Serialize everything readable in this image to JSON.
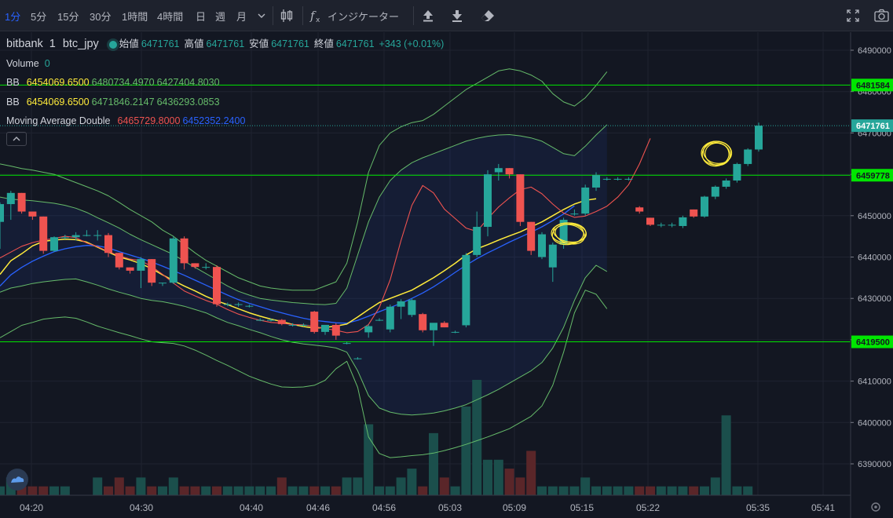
{
  "toolbar": {
    "intervals": [
      "1分",
      "5分",
      "15分",
      "30分",
      "1時間",
      "4時間",
      "日",
      "週",
      "月"
    ],
    "active_interval": "1分",
    "indicators_label": "インジケーター",
    "icons": [
      "chevron-down-icon",
      "candles-icon",
      "fx-icon",
      "upload-icon",
      "download-icon",
      "eraser-icon",
      "fullscreen-icon",
      "camera-icon"
    ]
  },
  "legend": {
    "exchange": "bitbank",
    "interval": "1",
    "symbol": "btc_jpy",
    "open_label": "始値",
    "open": "6471761",
    "high_label": "高値",
    "high": "6471761",
    "low_label": "安値",
    "low": "6471761",
    "close_label": "終値",
    "close": "6471761",
    "change": "+343 (+0.01%)",
    "volume_label": "Volume",
    "volume": "0",
    "bb1": {
      "label": "BB",
      "basis": "6454069.6500",
      "upper": "6480734.4970",
      "lower": "6427404.8030"
    },
    "bb2": {
      "label": "BB",
      "basis": "6454069.6500",
      "upper": "6471846.2147",
      "lower": "6436293.0853"
    },
    "ma": {
      "label": "Moving Average Double",
      "v1": "6465729.8000",
      "v2": "6452352.2400"
    }
  },
  "price_axis": {
    "ticks": [
      "6490000",
      "6480000",
      "6470000",
      "6460000",
      "6450000",
      "6440000",
      "6430000",
      "6420000",
      "6410000",
      "6400000",
      "6390000"
    ],
    "min": 6385000,
    "max": 6494000,
    "markers": [
      {
        "label": "6481584",
        "bg": "#00e600",
        "fg": "#131722"
      },
      {
        "label": "6471761",
        "bg": "#26a69a",
        "fg": "#ffffff"
      },
      {
        "label": "6459778",
        "bg": "#00e600",
        "fg": "#131722"
      },
      {
        "label": "6419500",
        "bg": "#00e600",
        "fg": "#131722"
      }
    ]
  },
  "time_axis": {
    "labels": [
      "04:20",
      "04:30",
      "04:40",
      "04:46",
      "04:56",
      "05:03",
      "05:09",
      "05:15",
      "05:22",
      "05:35",
      "05:41"
    ]
  },
  "chart_data": {
    "type": "candlestick",
    "x_labels": [
      "04:20",
      "04:30",
      "04:40",
      "04:46",
      "04:56",
      "05:03",
      "05:09",
      "05:15",
      "05:22",
      "05:35",
      "05:41"
    ],
    "horizontal_lines": [
      6481584,
      6459778,
      6419500
    ],
    "last_price": 6471761,
    "colors": {
      "up": "#26a69a",
      "down": "#ef5350",
      "hline": "#00e600",
      "bb": "#66bb6a",
      "basis_band": "#ffeb3b",
      "ma_fast": "#ef5350",
      "ma_slow": "#2962ff"
    },
    "candles": [
      {
        "o": 6448500,
        "h": 6453200,
        "l": 6442000,
        "c": 6452800
      },
      {
        "o": 6452800,
        "h": 6456000,
        "l": 6449000,
        "c": 6455500
      },
      {
        "o": 6455500,
        "h": 6455500,
        "l": 6450500,
        "c": 6451000
      },
      {
        "o": 6451000,
        "h": 6451000,
        "l": 6449000,
        "c": 6449800
      },
      {
        "o": 6449800,
        "h": 6449800,
        "l": 6440800,
        "c": 6441500
      },
      {
        "o": 6441500,
        "h": 6445000,
        "l": 6441200,
        "c": 6444800
      },
      {
        "o": 6444800,
        "h": 6445400,
        "l": 6444300,
        "c": 6444800
      },
      {
        "o": 6444800,
        "h": 6446000,
        "l": 6444000,
        "c": 6445300
      },
      {
        "o": 6445300,
        "h": 6446500,
        "l": 6445000,
        "c": 6445300
      },
      {
        "o": 6445300,
        "h": 6446500,
        "l": 6444000,
        "c": 6445300
      },
      {
        "o": 6445300,
        "h": 6445800,
        "l": 6440000,
        "c": 6441000
      },
      {
        "o": 6441000,
        "h": 6441000,
        "l": 6437000,
        "c": 6437500
      },
      {
        "o": 6437500,
        "h": 6437500,
        "l": 6436000,
        "c": 6436700
      },
      {
        "o": 6436700,
        "h": 6440000,
        "l": 6432500,
        "c": 6439500
      },
      {
        "o": 6439500,
        "h": 6439500,
        "l": 6433000,
        "c": 6433800
      },
      {
        "o": 6433800,
        "h": 6433800,
        "l": 6433000,
        "c": 6433800
      },
      {
        "o": 6433800,
        "h": 6445000,
        "l": 6433500,
        "c": 6444500
      },
      {
        "o": 6444500,
        "h": 6445000,
        "l": 6437000,
        "c": 6438500
      },
      {
        "o": 6438500,
        "h": 6438500,
        "l": 6437200,
        "c": 6437600
      },
      {
        "o": 6437600,
        "h": 6438500,
        "l": 6437000,
        "c": 6437600
      },
      {
        "o": 6437600,
        "h": 6438000,
        "l": 6428000,
        "c": 6428600
      },
      {
        "o": 6428600,
        "h": 6429000,
        "l": 6428100,
        "c": 6428600
      },
      {
        "o": 6428600,
        "h": 6429000,
        "l": 6428000,
        "c": 6428600
      },
      {
        "o": 6428200,
        "h": 6428500,
        "l": 6427800,
        "c": 6428200
      },
      {
        "o": 6424800,
        "h": 6425200,
        "l": 6424500,
        "c": 6424800
      },
      {
        "o": 6424800,
        "h": 6425200,
        "l": 6424400,
        "c": 6424800
      },
      {
        "o": 6424800,
        "h": 6425000,
        "l": 6423500,
        "c": 6423800
      },
      {
        "o": 6423600,
        "h": 6424000,
        "l": 6423200,
        "c": 6423600
      },
      {
        "o": 6423600,
        "h": 6424000,
        "l": 6423200,
        "c": 6423600
      },
      {
        "o": 6426800,
        "h": 6427000,
        "l": 6421500,
        "c": 6421900
      },
      {
        "o": 6421900,
        "h": 6422500,
        "l": 6421200,
        "c": 6423600
      },
      {
        "o": 6423600,
        "h": 6424000,
        "l": 6420000,
        "c": 6421000
      },
      {
        "o": 6419200,
        "h": 6419500,
        "l": 6418900,
        "c": 6419200
      },
      {
        "o": 6415500,
        "h": 6415800,
        "l": 6415200,
        "c": 6415500
      },
      {
        "o": 6421800,
        "h": 6423700,
        "l": 6420500,
        "c": 6423300
      },
      {
        "o": 6424800,
        "h": 6425200,
        "l": 6424500,
        "c": 6424800
      },
      {
        "o": 6422500,
        "h": 6428500,
        "l": 6421800,
        "c": 6428000
      },
      {
        "o": 6428000,
        "h": 6429800,
        "l": 6425000,
        "c": 6429300
      },
      {
        "o": 6426000,
        "h": 6430000,
        "l": 6425500,
        "c": 6429600
      },
      {
        "o": 6426200,
        "h": 6426500,
        "l": 6421800,
        "c": 6422300
      },
      {
        "o": 6422300,
        "h": 6422600,
        "l": 6418500,
        "c": 6424100
      },
      {
        "o": 6424100,
        "h": 6424500,
        "l": 6423000,
        "c": 6423000
      },
      {
        "o": 6421900,
        "h": 6422200,
        "l": 6421600,
        "c": 6421900
      },
      {
        "o": 6423500,
        "h": 6441000,
        "l": 6423000,
        "c": 6440500
      },
      {
        "o": 6440500,
        "h": 6451000,
        "l": 6440000,
        "c": 6447300
      },
      {
        "o": 6447300,
        "h": 6461000,
        "l": 6445000,
        "c": 6460000
      },
      {
        "o": 6460500,
        "h": 6462500,
        "l": 6458500,
        "c": 6461500
      },
      {
        "o": 6461500,
        "h": 6461500,
        "l": 6459000,
        "c": 6460000
      },
      {
        "o": 6460000,
        "h": 6460000,
        "l": 6447500,
        "c": 6448500
      },
      {
        "o": 6448500,
        "h": 6448500,
        "l": 6440500,
        "c": 6441500
      },
      {
        "o": 6440000,
        "h": 6446000,
        "l": 6439500,
        "c": 6445500
      },
      {
        "o": 6437500,
        "h": 6443500,
        "l": 6434000,
        "c": 6443000
      },
      {
        "o": 6443000,
        "h": 6449500,
        "l": 6442000,
        "c": 6449000
      },
      {
        "o": 6450500,
        "h": 6451500,
        "l": 6450000,
        "c": 6450500
      },
      {
        "o": 6450500,
        "h": 6457500,
        "l": 6450000,
        "c": 6456800
      },
      {
        "o": 6456800,
        "h": 6460500,
        "l": 6456000,
        "c": 6459800
      },
      {
        "o": 6458900,
        "h": 6459300,
        "l": 6458500,
        "c": 6458900
      },
      {
        "o": 6458900,
        "h": 6459300,
        "l": 6458500,
        "c": 6458900
      },
      {
        "o": 6458900,
        "h": 6459300,
        "l": 6458500,
        "c": 6458900
      },
      {
        "o": 6452000,
        "h": 6452300,
        "l": 6450500,
        "c": 6451000
      },
      {
        "o": 6449500,
        "h": 6449500,
        "l": 6447500,
        "c": 6447800
      },
      {
        "o": 6447800,
        "h": 6448300,
        "l": 6447200,
        "c": 6447800
      },
      {
        "o": 6447800,
        "h": 6448300,
        "l": 6447200,
        "c": 6447800
      },
      {
        "o": 6447500,
        "h": 6450000,
        "l": 6447000,
        "c": 6449600
      },
      {
        "o": 6451500,
        "h": 6451500,
        "l": 6449500,
        "c": 6449800
      },
      {
        "o": 6449800,
        "h": 6454800,
        "l": 6449500,
        "c": 6454600
      },
      {
        "o": 6454600,
        "h": 6457300,
        "l": 6454000,
        "c": 6457000
      },
      {
        "o": 6457000,
        "h": 6459000,
        "l": 6456500,
        "c": 6458500
      },
      {
        "o": 6458500,
        "h": 6462800,
        "l": 6458000,
        "c": 6462500
      },
      {
        "o": 6462500,
        "h": 6466300,
        "l": 6462000,
        "c": 6466000
      },
      {
        "o": 6466000,
        "h": 6472500,
        "l": 6465500,
        "c": 6471761
      }
    ],
    "volumes": [
      1,
      2,
      1,
      1,
      1,
      1,
      1,
      0,
      0,
      2,
      1,
      2,
      1,
      2,
      1,
      1,
      2,
      1,
      1,
      1,
      1,
      1,
      1,
      1,
      1,
      1,
      2,
      1,
      1,
      1,
      1,
      1,
      2,
      2,
      8,
      1,
      1,
      2,
      3,
      1,
      7,
      2,
      1,
      10,
      13,
      4,
      4,
      3,
      2,
      5,
      1,
      1,
      1,
      1,
      2,
      1,
      1,
      1,
      1,
      1,
      1,
      1,
      1,
      1,
      1,
      1,
      2,
      9,
      1,
      1,
      0
    ],
    "bb_outer_upper": [
      6462500,
      6462000,
      6461400,
      6461000,
      6460500,
      6460000,
      6459000,
      6458000,
      6457000,
      6456000,
      6454800,
      6453200,
      6451500,
      6450000,
      6448500,
      6446500,
      6445000,
      6443000,
      6441000,
      6439200,
      6437800,
      6436400,
      6435000,
      6434000,
      6433000,
      6432500,
      6432200,
      6432000,
      6432000,
      6432000,
      6433000,
      6434000,
      6438500,
      6448500,
      6460500,
      6467000,
      6470000,
      6471500,
      6472500,
      6473000,
      6474500,
      6476500,
      6478500,
      6480500,
      6482000,
      6483500,
      6485000,
      6485500,
      6485000,
      6484000,
      6482500,
      6479500,
      6477500,
      6476500,
      6478500,
      6481500,
      6484800
    ],
    "bb_inner_upper": [
      6454500,
      6454000,
      6453800,
      6453600,
      6453300,
      6453000,
      6452500,
      6451800,
      6450800,
      6449500,
      6448300,
      6447000,
      6445500,
      6444200,
      6443000,
      6441800,
      6440600,
      6439000,
      6437500,
      6436000,
      6434500,
      6433000,
      6431700,
      6430800,
      6430000,
      6429600,
      6429300,
      6429000,
      6428800,
      6428600,
      6428500,
      6428800,
      6432500,
      6440500,
      6448500,
      6454500,
      6458500,
      6461000,
      6462800,
      6464000,
      6465000,
      6466000,
      6467000,
      6468000,
      6468700,
      6469200,
      6469500,
      6469600,
      6469300,
      6468800,
      6468000,
      6466500,
      6465000,
      6464500,
      6466800,
      6469500,
      6472000
    ],
    "bb_inner_lower": [
      6431500,
      6432500,
      6433000,
      6433600,
      6434000,
      6434300,
      6434600,
      6434700,
      6434000,
      6433200,
      6432300,
      6431500,
      6430800,
      6430000,
      6429500,
      6429200,
      6428700,
      6428100,
      6427300,
      6426500,
      6425300,
      6424200,
      6423400,
      6422500,
      6421700,
      6420800,
      6420000,
      6419400,
      6419000,
      6418700,
      6418400,
      6418000,
      6417000,
      6412500,
      6406500,
      6403500,
      6402500,
      6402000,
      6401800,
      6402000,
      6402300,
      6402800,
      6403500,
      6404300,
      6405500,
      6406700,
      6408000,
      6409500,
      6411000,
      6412500,
      6414500,
      6418000,
      6423000,
      6429500,
      6435000,
      6438000,
      6436500
    ],
    "bb_outer_lower": [
      6420500,
      6422000,
      6423500,
      6424200,
      6425000,
      6425300,
      6425500,
      6425200,
      6424300,
      6423300,
      6422500,
      6421700,
      6421000,
      6420200,
      6419500,
      6419300,
      6419100,
      6418500,
      6417500,
      6416300,
      6415000,
      6413800,
      6412500,
      6411200,
      6410200,
      6409300,
      6408600,
      6408500,
      6408600,
      6409000,
      6410200,
      6413000,
      6414800,
      6408500,
      6396500,
      6392500,
      6391500,
      6391700,
      6392000,
      6392200,
      6392600,
      6393200,
      6393900,
      6394700,
      6395600,
      6396500,
      6397500,
      6398500,
      6400000,
      6401500,
      6404000,
      6409000,
      6417000,
      6426500,
      6432000,
      6431000,
      6427500
    ],
    "ma_fast": [
      6439800,
      6441200,
      6442600,
      6443500,
      6444100,
      6444500,
      6445000,
      6444700,
      6443400,
      6442500,
      6441300,
      6440300,
      6439500,
      6439100,
      6437700,
      6435800,
      6433700,
      6431800,
      6430600,
      6429500,
      6428600,
      6427300,
      6426200,
      6425400,
      6424700,
      6424200,
      6424000,
      6423700,
      6423600,
      6423200,
      6422700,
      6422300,
      6421700,
      6422000,
      6423700,
      6427800,
      6434500,
      6444000,
      6452500,
      6457300,
      6455500,
      6451600,
      6449300,
      6447000,
      6446200,
      6449300,
      6452100,
      6454300,
      6456300,
      6456900,
      6455300,
      6452800,
      6450600,
      6449600,
      6449900,
      6451000,
      6452300,
      6454500,
      6457500,
      6462500,
      6468700
    ],
    "ma_basis": [
      6435800,
      6439100,
      6440800,
      6442700,
      6443800,
      6444100,
      6444300,
      6444200,
      6443600,
      6442400,
      6441200,
      6440000,
      6439300,
      6438400,
      6437200,
      6435700,
      6434300,
      6433000,
      6431800,
      6430500,
      6429400,
      6428500,
      6427500,
      6426500,
      6425700,
      6425000,
      6424400,
      6423700,
      6423200,
      6422800,
      6423000,
      6423300,
      6423800,
      6425500,
      6427300,
      6429000,
      6430000,
      6431000,
      6432000,
      6433500,
      6435000,
      6436700,
      6438500,
      6440500,
      6442000,
      6443000,
      6444100,
      6445100,
      6446100,
      6447300,
      6448500,
      6450000,
      6451500,
      6452800,
      6453700,
      6454100
    ],
    "ma_slow": [
      6433000,
      6435700,
      6437500,
      6439000,
      6440200,
      6441300,
      6442000,
      6442500,
      6442800,
      6442700,
      6442200,
      6441300,
      6440500,
      6439700,
      6438800,
      6437800,
      6436700,
      6435600,
      6434400,
      6433200,
      6432000,
      6430800,
      6429700,
      6428800,
      6428000,
      6427200,
      6426500,
      6425800,
      6425200,
      6424700,
      6424400,
      6424100,
      6424000,
      6424700,
      6425700,
      6426800,
      6427800,
      6428800,
      6430000,
      6431300,
      6432800,
      6434500,
      6436300,
      6438000,
      6439600,
      6441000,
      6442300,
      6443600,
      6444800,
      6446000,
      6447300,
      6448800,
      6450400,
      6452400
    ]
  }
}
